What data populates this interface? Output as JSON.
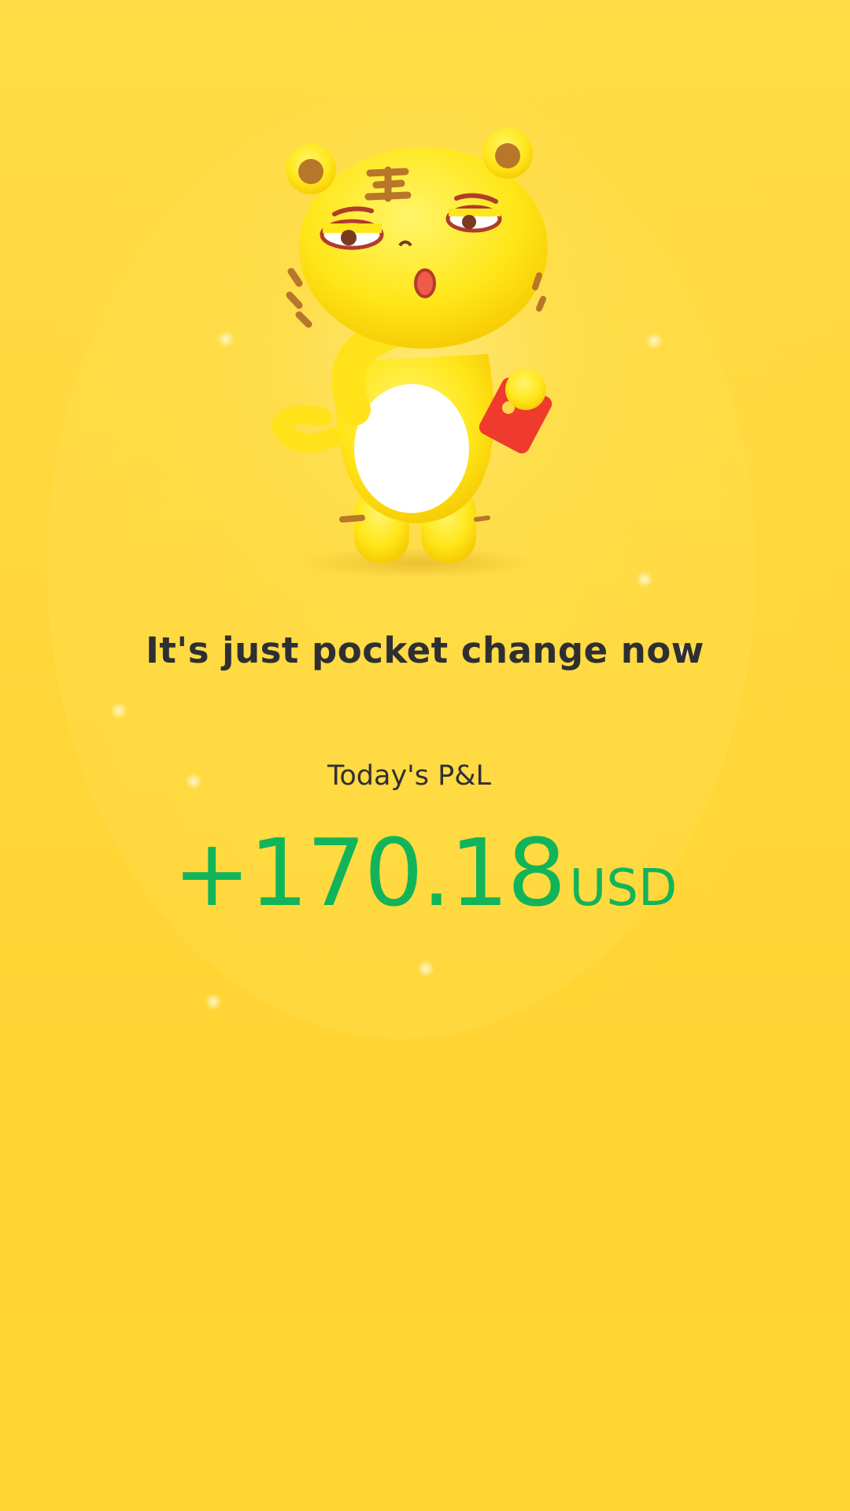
{
  "headline": "It's just pocket change now",
  "pnl": {
    "label": "Today's P&L",
    "amount": "+170.18",
    "currency": "USD",
    "color": "#12b45a"
  },
  "mascot": {
    "icon": "tiger-mascot-illustration"
  },
  "colors": {
    "background": "#ffd633",
    "text": "#2e2f33",
    "accent_red": "#ef3b2d"
  }
}
